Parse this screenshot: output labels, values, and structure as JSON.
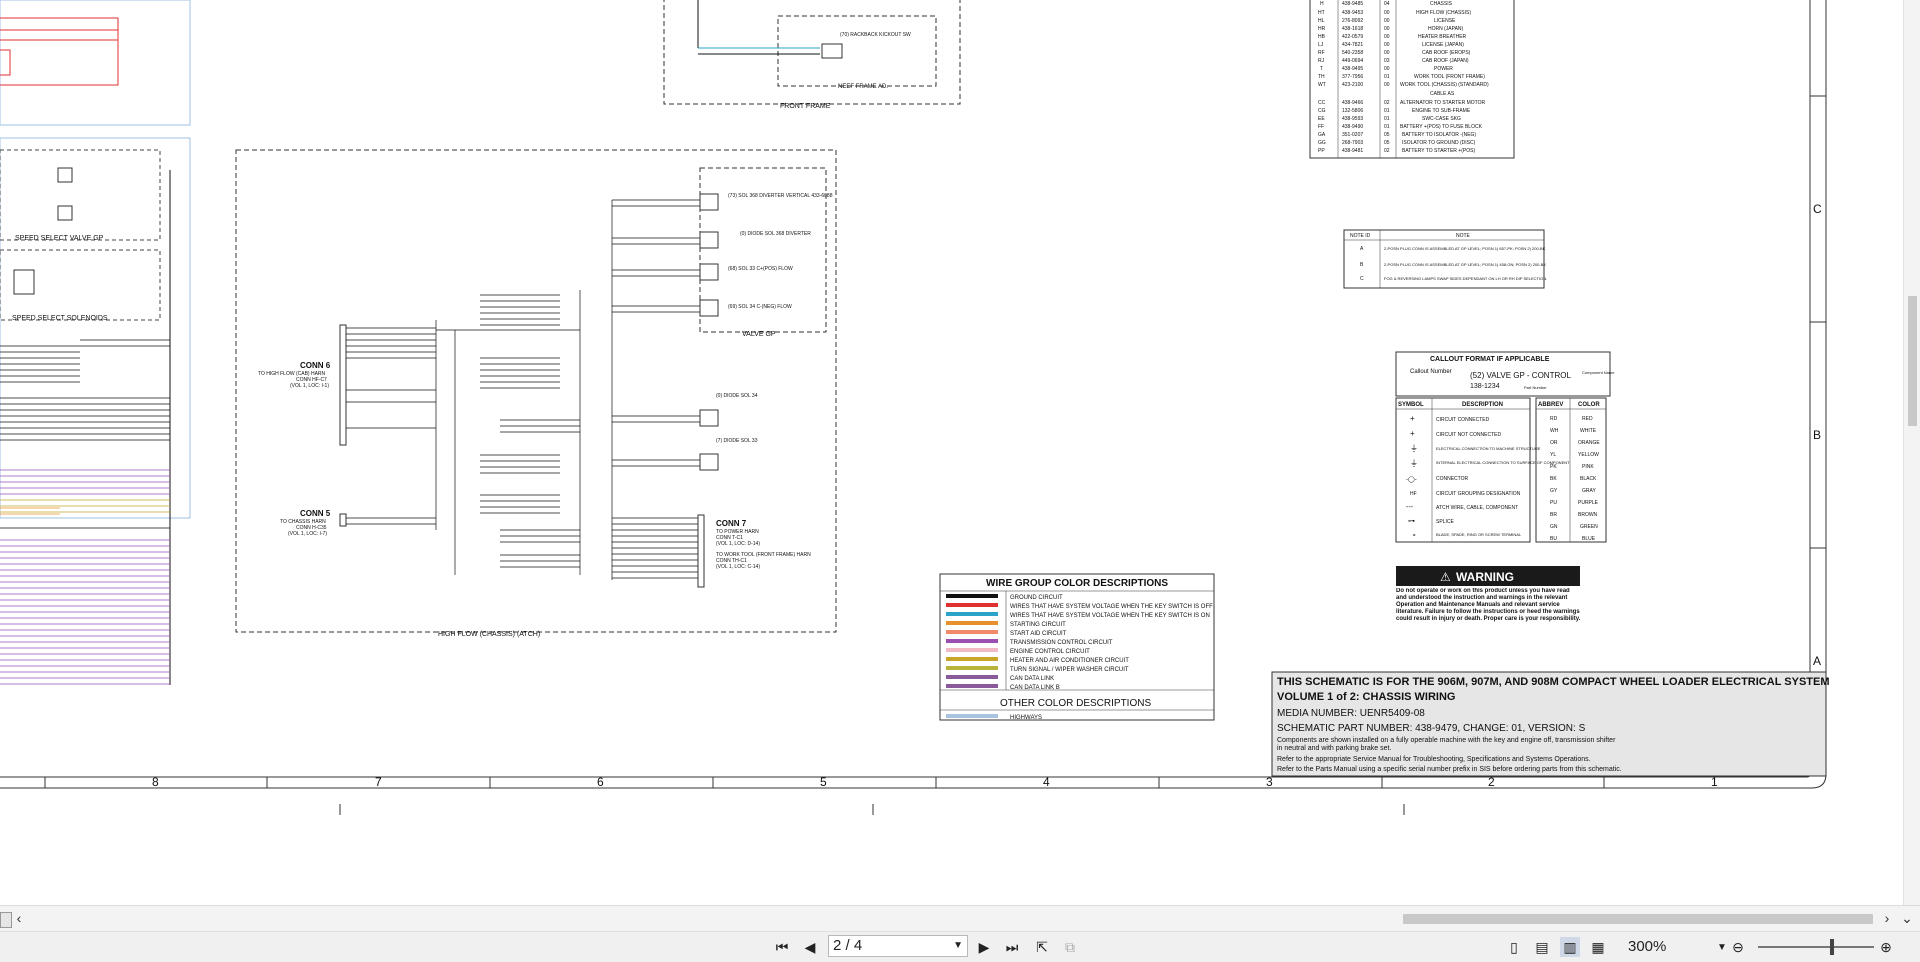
{
  "schematic": {
    "high_flow_frame_label": "HIGH FLOW (CHASSIS) (ATCH)",
    "front_frame_label": "FRONT FRAME",
    "neef_frame_label": "NEEF FRAME AD.",
    "speed_select_valve_label": "SPEED SELECT VALVE GP",
    "speed_select_solenoids_label": "SPEED SELECT SOLENOIDS",
    "valve_gp_label": "VALVE GP",
    "conn6": {
      "title": "CONN 6",
      "desc": "TO HIGH FLOW (CAB) HARN",
      "desc2": "CONN HF-C7",
      "desc3": "(VOL 1, LOC: I-1)"
    },
    "conn5": {
      "title": "CONN 5",
      "desc": "TO CHASSIS HARN",
      "desc2": "CONN H-C35",
      "desc3": "(VOL 1, LOC: I-7)"
    },
    "conn7": {
      "title": "CONN 7",
      "desc": "TO POWER HARN",
      "desc2": "CONN T-C1",
      "desc3": "(VOL 1, LOC: D-14)",
      "desc4": "TO WORK TOOL (FRONT FRAME) HARN",
      "desc5": "CONN TH-C1",
      "desc6": "(VOL 1, LOC: C-14)"
    },
    "hf_c3": "(73) SOL 368 DIVERTER VERTICAL 433-6088",
    "hf_c4": "(0) DIODE SOL 368 DIVERTER",
    "hf_c6": "(68) SOL 33 C+(POS) FLOW",
    "hf_c8": "(69) SOL 34 C-(NEG) FLOW",
    "hf_c7": "(0) DIODE SOL 34",
    "hf_c9": "(7) DIODE SOL 33",
    "kickout": "(70) RACKBACK KICKOUT SW",
    "zone_numbers": [
      "8",
      "7",
      "6",
      "5",
      "4",
      "3",
      "2",
      "1"
    ],
    "row_letters": [
      "C",
      "B",
      "A"
    ]
  },
  "harness_table": {
    "rows": [
      [
        "H",
        "438-9485",
        "04",
        "CHASSIS"
      ],
      [
        "HT",
        "438-9453",
        "00",
        "HIGH FLOW (CHASSIS)"
      ],
      [
        "HL",
        "276-8092",
        "00",
        "LICENSE"
      ],
      [
        "HR",
        "438-1618",
        "00",
        "HORN (JAPAN)"
      ],
      [
        "HB",
        "422-0579",
        "00",
        "HEATER BREATHER"
      ],
      [
        "LJ",
        "434-7821",
        "00",
        "LICENSE (JAPAN)"
      ],
      [
        "RF",
        "540-2358",
        "00",
        "CAB ROOF (EROPS)"
      ],
      [
        "RJ",
        "449-0694",
        "03",
        "CAB ROOF (JAPAN)"
      ],
      [
        "T",
        "438-9495",
        "00",
        "POWER"
      ],
      [
        "TH",
        "377-7956",
        "01",
        "WORK TOOL (FRONT FRAME)"
      ],
      [
        "WT",
        "423-2100",
        "00",
        "WORK TOOL (CHASSIS) (STANDARD)"
      ]
    ],
    "cable_header": "CABLE AS",
    "cable_rows": [
      [
        "CC",
        "438-9466",
        "02",
        "ALTERNATOR TO STARTER MOTOR"
      ],
      [
        "CG",
        "132-5806",
        "01",
        "ENGINE TO SUB-FRAME"
      ],
      [
        "EE",
        "438-9593",
        "01",
        "SWC-CASE SKG"
      ],
      [
        "FF",
        "438-9490",
        "01",
        "BATTERY +(POS) TO FUSE BLOCK"
      ],
      [
        "GA",
        "351-0207",
        "05",
        "BATTERY TO ISOLATOR -(NEG)"
      ],
      [
        "GG",
        "268-7903",
        "05",
        "ISOLATOR TO GROUND (DISC)"
      ],
      [
        "PP",
        "438-9481",
        "02",
        "BATTERY TO STARTER +(POS)"
      ]
    ]
  },
  "note_table": {
    "headers": [
      "NOTE ID",
      "NOTE"
    ],
    "rows": [
      [
        "A",
        "2-POSN PLUG CONN IS ASSEMBLED AT GP LEVEL; POSN 1) 657-PK; POSN 2) 200-BK"
      ],
      [
        "B",
        "2-POSN PLUG CONN IS ASSEMBLED AT GP LEVEL; POSN 1) 458-GN; POSN 2) 200-BK"
      ],
      [
        "C",
        "FOG & REVERSING LAMPS SWAP SIDES DEPENDANT ON LH OR RH DIP SELECTION."
      ]
    ]
  },
  "callout": {
    "title": "CALLOUT FORMAT IF APPLICABLE",
    "callout_number": "Callout Number",
    "example": "(52) VALVE GP - CONTROL",
    "part": "138-1234",
    "component_name": "Component Name",
    "part_number": "Part Number"
  },
  "symbol_table": {
    "headers": [
      "SYMBOL",
      "DESCRIPTION"
    ],
    "rows": [
      [
        "+",
        "CIRCUIT CONNECTED"
      ],
      [
        "+",
        "CIRCUIT NOT CONNECTED"
      ],
      [
        "⏚",
        "ELECTRICAL CONNECTION TO MACHINE STRUCTURE"
      ],
      [
        "⏚",
        "INTERNAL ELECTRICAL CONNECTION TO SURFACE OF COMPONENT"
      ],
      [
        "-◯-",
        "CONNECTOR"
      ],
      [
        "HF",
        "CIRCUIT GROUPING DESIGNATION"
      ],
      [
        "---",
        "ATCH WIRE, CABLE, COMPONENT"
      ],
      [
        "⊶",
        "SPLICE"
      ],
      [
        "∘",
        "BLADE, SPADE, RING OR SCREW TERMINAL"
      ]
    ]
  },
  "color_table": {
    "headers": [
      "ABBREV",
      "COLOR"
    ],
    "rows": [
      [
        "RD",
        "RED"
      ],
      [
        "WH",
        "WHITE"
      ],
      [
        "OR",
        "ORANGE"
      ],
      [
        "YL",
        "YELLOW"
      ],
      [
        "PK",
        "PINK"
      ],
      [
        "BK",
        "BLACK"
      ],
      [
        "GY",
        "GRAY"
      ],
      [
        "PU",
        "PURPLE"
      ],
      [
        "BR",
        "BROWN"
      ],
      [
        "GN",
        "GREEN"
      ],
      [
        "BU",
        "BLUE"
      ]
    ]
  },
  "warning": {
    "title": "WARNING",
    "text": "Do not operate or work on this product unless you have read and understood the instruction and warnings in the relevant Operation and Maintenance Manuals and relevant service literature. Failure to follow the instructions or heed the warnings could result in injury or death. Proper care is your responsibility."
  },
  "wire_colors": {
    "title": "WIRE GROUP COLOR DESCRIPTIONS",
    "rows": [
      {
        "color": "#111111",
        "label": "GROUND CIRCUIT"
      },
      {
        "color": "#e03030",
        "label": "WIRES THAT HAVE SYSTEM VOLTAGE WHEN THE KEY SWITCH IS OFF"
      },
      {
        "color": "#2aa3c9",
        "label": "WIRES THAT HAVE SYSTEM VOLTAGE WHEN THE KEY SWITCH IS ON"
      },
      {
        "color": "#e8902a",
        "label": "STARTING CIRCUIT"
      },
      {
        "color": "#f08a6a",
        "label": "START AID CIRCUIT"
      },
      {
        "color": "#9b4fb0",
        "label": "TRANSMISSION CONTROL CIRCUIT"
      },
      {
        "color": "#f2b8c4",
        "label": "ENGINE CONTROL CIRCUIT"
      },
      {
        "color": "#c9a52a",
        "label": "HEATER AND AIR CONDITIONER CIRCUIT"
      },
      {
        "color": "#b8b33a",
        "label": "TURN SIGNAL / WIPER WASHER CIRCUIT"
      },
      {
        "color": "#8a5a9a",
        "label": "CAN DATA LINK"
      },
      {
        "color": "#8a5a9a",
        "label": "CAN DATA LINK B"
      }
    ],
    "other_title": "OTHER COLOR DESCRIPTIONS",
    "other_rows": [
      {
        "color": "#a8c4e0",
        "label": "HIGHWAYS"
      }
    ]
  },
  "title_block": {
    "line1": "THIS SCHEMATIC IS FOR THE 906M, 907M, AND 908M COMPACT WHEEL LOADER ELECTRICAL SYSTEM",
    "line2": "VOLUME 1 of 2: CHASSIS WIRING",
    "line3": "MEDIA NUMBER: UENR5409-08",
    "line4": "SCHEMATIC PART NUMBER: 438-9479, CHANGE: 01, VERSION: S",
    "line5": "Components are shown installed on a fully operable machine with the key and engine off, transmission shifter",
    "line6": "in neutral and with parking brake set.",
    "line7": "Refer to the appropriate Service Manual for Troubleshooting, Specifications and Systems Operations.",
    "line8": "Refer to the Parts Manual using a specific serial number prefix in SIS before ordering parts from this schematic."
  },
  "toolbar": {
    "page_value": "2 / 4",
    "zoom_value": "300%"
  }
}
